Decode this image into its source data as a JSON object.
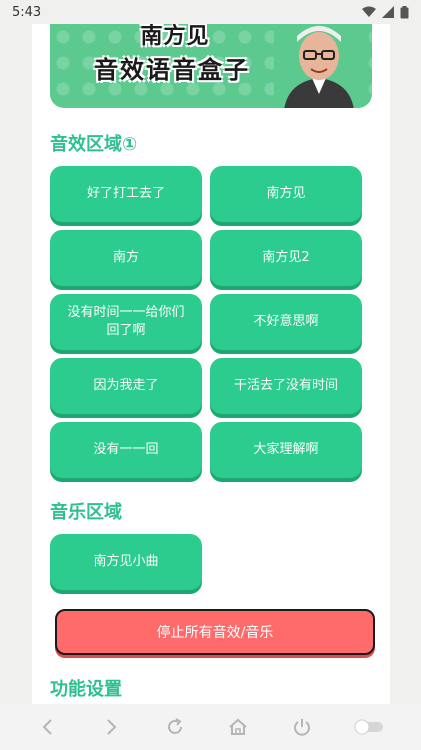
{
  "status_bar": {
    "time": "5:43"
  },
  "banner": {
    "title": "南方见",
    "subtitle": "音效语音盒子"
  },
  "sections": {
    "effects": {
      "title": "音效区域①",
      "buttons": [
        "好了打工去了",
        "南方见",
        "南方",
        "南方见2",
        "没有时间一一给你们回了啊",
        "不好意思啊",
        "因为我走了",
        "干活去了没有时间",
        "没有一一回",
        "大家理解啊"
      ]
    },
    "music": {
      "title": "音乐区域",
      "buttons": [
        "南方见小曲"
      ]
    },
    "stop_label": "停止所有音效/音乐",
    "settings": {
      "title": "功能设置"
    }
  },
  "colors": {
    "accent": "#2ccb8e",
    "accent_text": "#2fc08f",
    "stop": "#ff6b6b"
  },
  "nav": {
    "icons": [
      "back-icon",
      "forward-icon",
      "refresh-icon",
      "home-icon",
      "power-icon",
      "toggle-icon"
    ]
  }
}
